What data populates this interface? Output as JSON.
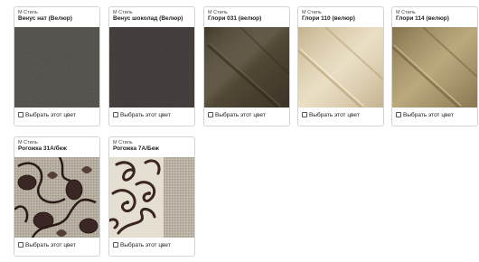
{
  "products": [
    {
      "brand": "М Стиль",
      "title": "Венус нат (Велюр)",
      "select_label": "Выбрать этот цвет",
      "swatch_color": "#4d4a44",
      "texture": "velour-flat"
    },
    {
      "brand": "М Стиль",
      "title": "Венус шоколад (Велюр)",
      "select_label": "Выбрать этот цвет",
      "swatch_color": "#3b3634",
      "texture": "velour-flat"
    },
    {
      "brand": "М Стиль",
      "title": "Глори 031 (велюр)",
      "select_label": "Выбрать этот цвет",
      "swatch_color": "#544a37",
      "texture": "velour-fold"
    },
    {
      "brand": "М Стиль",
      "title": "Глори 110 (велюр)",
      "select_label": "Выбрать этот цвет",
      "swatch_color": "#e3d3b0",
      "texture": "velour-fold"
    },
    {
      "brand": "М Стиль",
      "title": "Глори 114 (велюр)",
      "select_label": "Выбрать этот цвет",
      "swatch_color": "#a8946a",
      "texture": "velour-fold"
    },
    {
      "brand": "М Стиль",
      "title": "Рогожка 31А/беж",
      "select_label": "Выбрать этот цвет",
      "swatch_color": "#b2aa9c",
      "texture": "floral-dark"
    },
    {
      "brand": "М Стиль",
      "title": "Рогожка 7А/Беж",
      "select_label": "Выбрать этот цвет",
      "swatch_color": "#b6ae9e",
      "texture": "floral-scroll"
    }
  ]
}
